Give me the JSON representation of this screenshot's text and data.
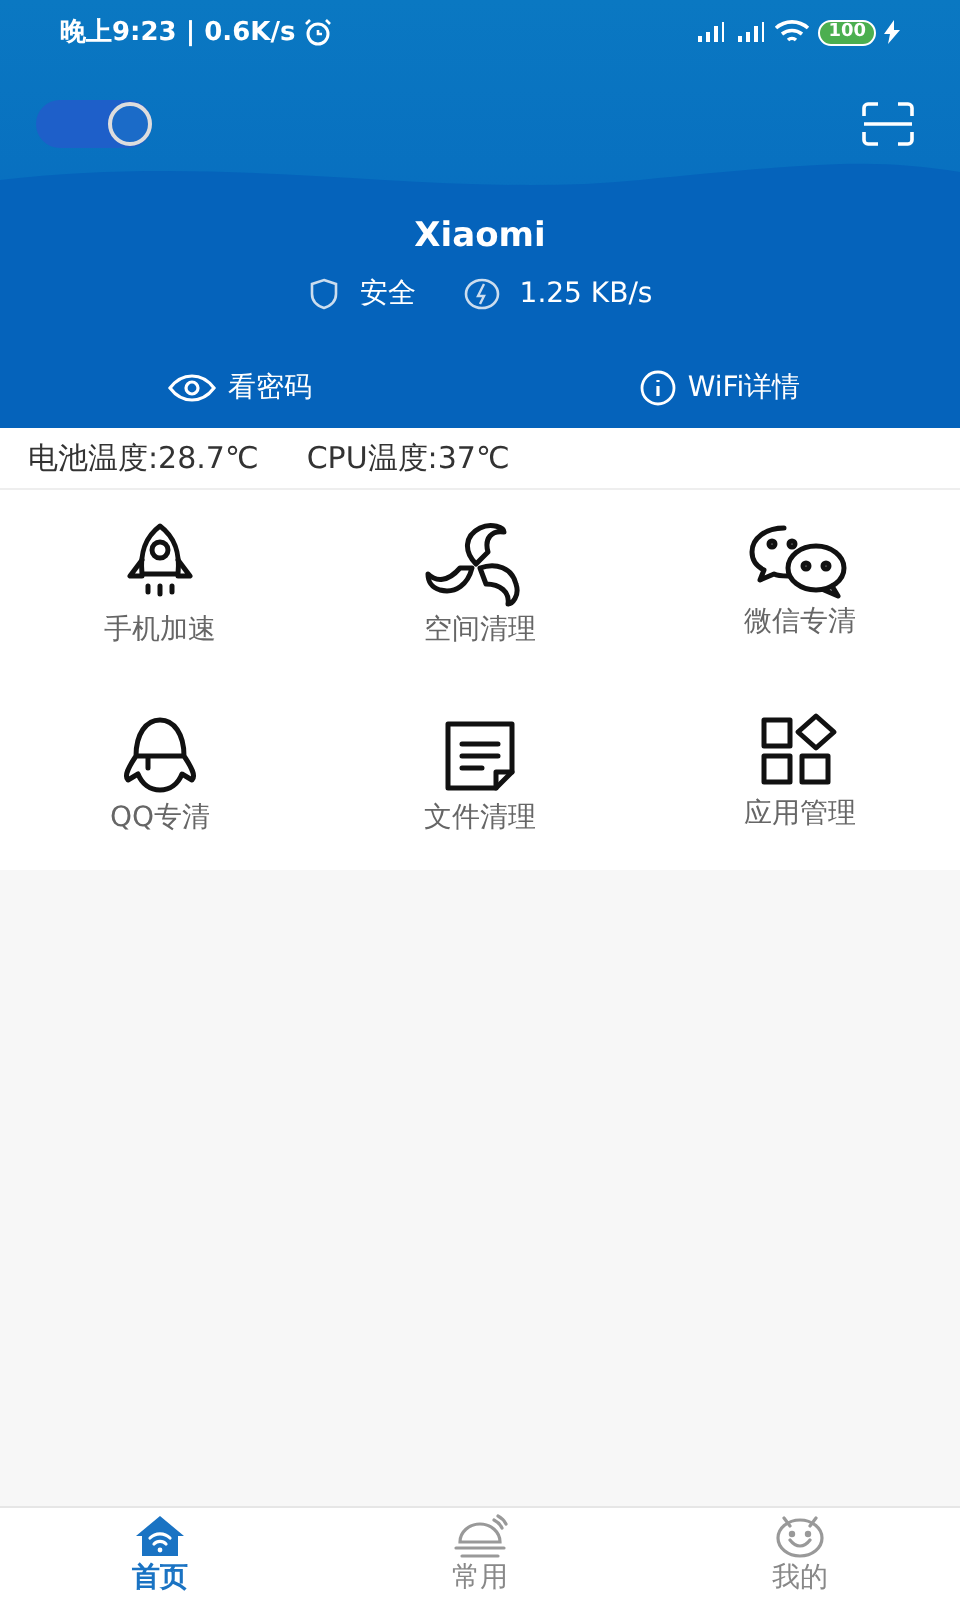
{
  "status_bar": {
    "time": "晚上9:23 | 0.6K/s",
    "battery": "100"
  },
  "header": {
    "toggle": {
      "on": true
    },
    "network_name": "Xiaomi",
    "security": "安全",
    "speed": "1.25 KB/s",
    "actions": [
      "看密码",
      "WiFi详情"
    ]
  },
  "temperatures": [
    "电池温度:28.7℃",
    "CPU温度:37℃"
  ],
  "tools": [
    {
      "label": "手机加速"
    },
    {
      "label": "空间清理"
    },
    {
      "label": "微信专清"
    },
    {
      "label": "QQ专清"
    },
    {
      "label": "文件清理"
    },
    {
      "label": "应用管理"
    }
  ],
  "bottom_nav": [
    {
      "label": "首页",
      "selected": true
    },
    {
      "label": "常用",
      "selected": false
    },
    {
      "label": "我的",
      "selected": false
    }
  ]
}
